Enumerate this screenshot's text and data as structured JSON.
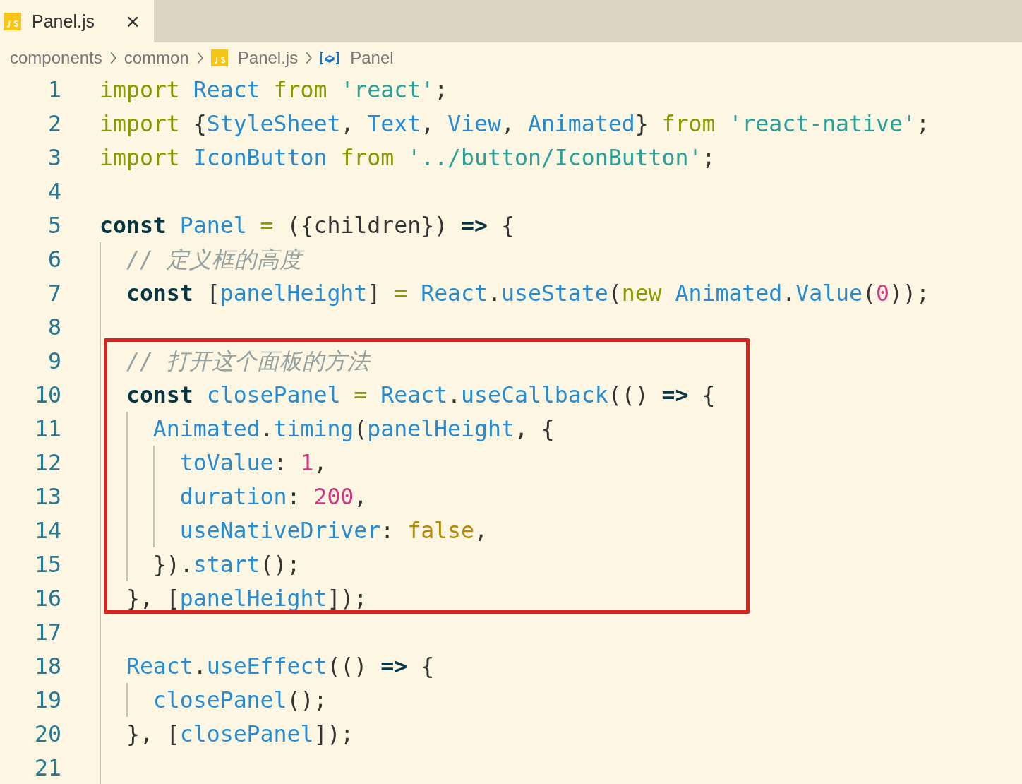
{
  "tabs": [
    {
      "label": "Panel.js",
      "selected": true,
      "close": "×"
    }
  ],
  "breadcrumb": [
    {
      "kind": "folder",
      "label": "components"
    },
    {
      "kind": "folder",
      "label": "common"
    },
    {
      "kind": "file",
      "label": "Panel.js"
    },
    {
      "kind": "symbol",
      "label": "Panel"
    }
  ],
  "editor": {
    "lines": [
      {
        "kind": "line",
        "number": "1",
        "tokens": [
          {
            "kind": "kw",
            "text": "import "
          },
          {
            "kind": "id",
            "text": "React "
          },
          {
            "kind": "kw",
            "text": "from "
          },
          {
            "kind": "str",
            "text": "'react'"
          },
          {
            "kind": "plain",
            "text": ";"
          }
        ]
      },
      {
        "kind": "line",
        "number": "2",
        "tokens": [
          {
            "kind": "kw",
            "text": "import "
          },
          {
            "kind": "plain",
            "text": "{"
          },
          {
            "kind": "id",
            "text": "StyleSheet"
          },
          {
            "kind": "plain",
            "text": ", "
          },
          {
            "kind": "id",
            "text": "Text"
          },
          {
            "kind": "plain",
            "text": ", "
          },
          {
            "kind": "id",
            "text": "View"
          },
          {
            "kind": "plain",
            "text": ", "
          },
          {
            "kind": "id",
            "text": "Animated"
          },
          {
            "kind": "plain",
            "text": "} "
          },
          {
            "kind": "kw",
            "text": "from "
          },
          {
            "kind": "str",
            "text": "'react-native'"
          },
          {
            "kind": "plain",
            "text": ";"
          }
        ]
      },
      {
        "kind": "line",
        "number": "3",
        "tokens": [
          {
            "kind": "kw",
            "text": "import "
          },
          {
            "kind": "id",
            "text": "IconButton "
          },
          {
            "kind": "kw",
            "text": "from "
          },
          {
            "kind": "str",
            "text": "'../button/IconButton'"
          },
          {
            "kind": "plain",
            "text": ";"
          }
        ]
      },
      {
        "kind": "line",
        "number": "4"
      },
      {
        "kind": "line",
        "number": "5",
        "tokens": [
          {
            "kind": "decl",
            "text": "const "
          },
          {
            "kind": "id",
            "text": "Panel "
          },
          {
            "kind": "op",
            "text": "= "
          },
          {
            "kind": "plain",
            "text": "({children}) "
          },
          {
            "kind": "arrow",
            "text": "=> "
          },
          {
            "kind": "plain",
            "text": "{"
          }
        ],
        "children": [
          {
            "kind": "line",
            "number": "6",
            "tokens": [
              {
                "kind": "cmt",
                "text": "// 定义框的高度"
              }
            ]
          },
          {
            "kind": "line",
            "number": "7",
            "tokens": [
              {
                "kind": "decl",
                "text": "const "
              },
              {
                "kind": "plain",
                "text": "["
              },
              {
                "kind": "id",
                "text": "panelHeight"
              },
              {
                "kind": "plain",
                "text": "] "
              },
              {
                "kind": "op",
                "text": "= "
              },
              {
                "kind": "id",
                "text": "React"
              },
              {
                "kind": "plain",
                "text": "."
              },
              {
                "kind": "id",
                "text": "useState"
              },
              {
                "kind": "plain",
                "text": "("
              },
              {
                "kind": "kw",
                "text": "new "
              },
              {
                "kind": "id",
                "text": "Animated"
              },
              {
                "kind": "plain",
                "text": "."
              },
              {
                "kind": "id",
                "text": "Value"
              },
              {
                "kind": "plain",
                "text": "("
              },
              {
                "kind": "num",
                "text": "0"
              },
              {
                "kind": "plain",
                "text": "));"
              }
            ]
          },
          {
            "kind": "line",
            "number": "8"
          },
          {
            "kind": "highlight",
            "children": [
              {
                "kind": "line",
                "number": "9",
                "tokens": [
                  {
                    "kind": "cmt",
                    "text": "// 打开这个面板的方法"
                  }
                ]
              },
              {
                "kind": "line",
                "number": "10",
                "tokens": [
                  {
                    "kind": "decl",
                    "text": "const "
                  },
                  {
                    "kind": "id",
                    "text": "closePanel "
                  },
                  {
                    "kind": "op",
                    "text": "= "
                  },
                  {
                    "kind": "id",
                    "text": "React"
                  },
                  {
                    "kind": "plain",
                    "text": "."
                  },
                  {
                    "kind": "id",
                    "text": "useCallback"
                  },
                  {
                    "kind": "plain",
                    "text": "(() "
                  },
                  {
                    "kind": "arrow",
                    "text": "=> "
                  },
                  {
                    "kind": "plain",
                    "text": "{"
                  }
                ],
                "children": [
                  {
                    "kind": "line",
                    "number": "11",
                    "tokens": [
                      {
                        "kind": "id",
                        "text": "Animated"
                      },
                      {
                        "kind": "plain",
                        "text": "."
                      },
                      {
                        "kind": "id",
                        "text": "timing"
                      },
                      {
                        "kind": "plain",
                        "text": "("
                      },
                      {
                        "kind": "id",
                        "text": "panelHeight"
                      },
                      {
                        "kind": "plain",
                        "text": ", {"
                      }
                    ],
                    "children": [
                      {
                        "kind": "line",
                        "number": "12",
                        "tokens": [
                          {
                            "kind": "id",
                            "text": "toValue"
                          },
                          {
                            "kind": "plain",
                            "text": ": "
                          },
                          {
                            "kind": "num",
                            "text": "1"
                          },
                          {
                            "kind": "plain",
                            "text": ","
                          }
                        ]
                      },
                      {
                        "kind": "line",
                        "number": "13",
                        "tokens": [
                          {
                            "kind": "id",
                            "text": "duration"
                          },
                          {
                            "kind": "plain",
                            "text": ": "
                          },
                          {
                            "kind": "num",
                            "text": "200"
                          },
                          {
                            "kind": "plain",
                            "text": ","
                          }
                        ]
                      },
                      {
                        "kind": "line",
                        "number": "14",
                        "tokens": [
                          {
                            "kind": "id",
                            "text": "useNativeDriver"
                          },
                          {
                            "kind": "plain",
                            "text": ": "
                          },
                          {
                            "kind": "bool",
                            "text": "false"
                          },
                          {
                            "kind": "plain",
                            "text": ","
                          }
                        ]
                      }
                    ]
                  },
                  {
                    "kind": "line",
                    "number": "15",
                    "tokens": [
                      {
                        "kind": "plain",
                        "text": "})."
                      },
                      {
                        "kind": "id",
                        "text": "start"
                      },
                      {
                        "kind": "plain",
                        "text": "();"
                      }
                    ]
                  }
                ]
              },
              {
                "kind": "line",
                "number": "16",
                "tokens": [
                  {
                    "kind": "plain",
                    "text": "}, ["
                  },
                  {
                    "kind": "id",
                    "text": "panelHeight"
                  },
                  {
                    "kind": "plain",
                    "text": "]);"
                  }
                ]
              }
            ]
          },
          {
            "kind": "line",
            "number": "17"
          },
          {
            "kind": "line",
            "number": "18",
            "tokens": [
              {
                "kind": "id",
                "text": "React"
              },
              {
                "kind": "plain",
                "text": "."
              },
              {
                "kind": "id",
                "text": "useEffect"
              },
              {
                "kind": "plain",
                "text": "(() "
              },
              {
                "kind": "arrow",
                "text": "=> "
              },
              {
                "kind": "plain",
                "text": "{"
              }
            ],
            "children": [
              {
                "kind": "line",
                "number": "19",
                "tokens": [
                  {
                    "kind": "id",
                    "text": "closePanel"
                  },
                  {
                    "kind": "plain",
                    "text": "();"
                  }
                ]
              }
            ]
          },
          {
            "kind": "line",
            "number": "20",
            "tokens": [
              {
                "kind": "plain",
                "text": "}, ["
              },
              {
                "kind": "id",
                "text": "closePanel"
              },
              {
                "kind": "plain",
                "text": "]);"
              }
            ]
          },
          {
            "kind": "line",
            "number": "21"
          }
        ]
      }
    ]
  }
}
